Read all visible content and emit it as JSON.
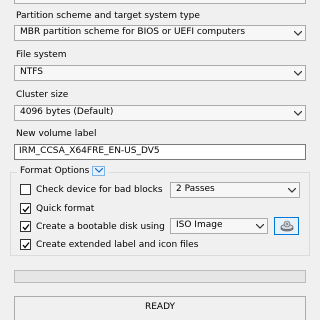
{
  "partition": {
    "label": "Partition scheme and target system type",
    "value": "MBR partition scheme for BIOS or UEFI computers"
  },
  "file_system": {
    "label": "File system",
    "value": "NTFS"
  },
  "cluster": {
    "label": "Cluster size",
    "value": "4096 bytes (Default)"
  },
  "volume": {
    "label": "New volume label",
    "value": "IRM_CCSA_X64FRE_EN-US_DV5"
  },
  "format_options": {
    "title": "Format Options",
    "bad_blocks": {
      "label": "Check device for bad blocks",
      "checked": false,
      "passes": "2 Passes"
    },
    "quick_format": {
      "label": "Quick format",
      "checked": true
    },
    "bootable": {
      "label": "Create a bootable disk using",
      "checked": true,
      "image_type": "ISO Image"
    },
    "extended": {
      "label": "Create extended label and icon files",
      "checked": true
    }
  },
  "progress": {
    "percent": 0
  },
  "status": {
    "text": "READY"
  },
  "colors": {
    "progress": "#06b025",
    "accent": "#0078d7"
  }
}
